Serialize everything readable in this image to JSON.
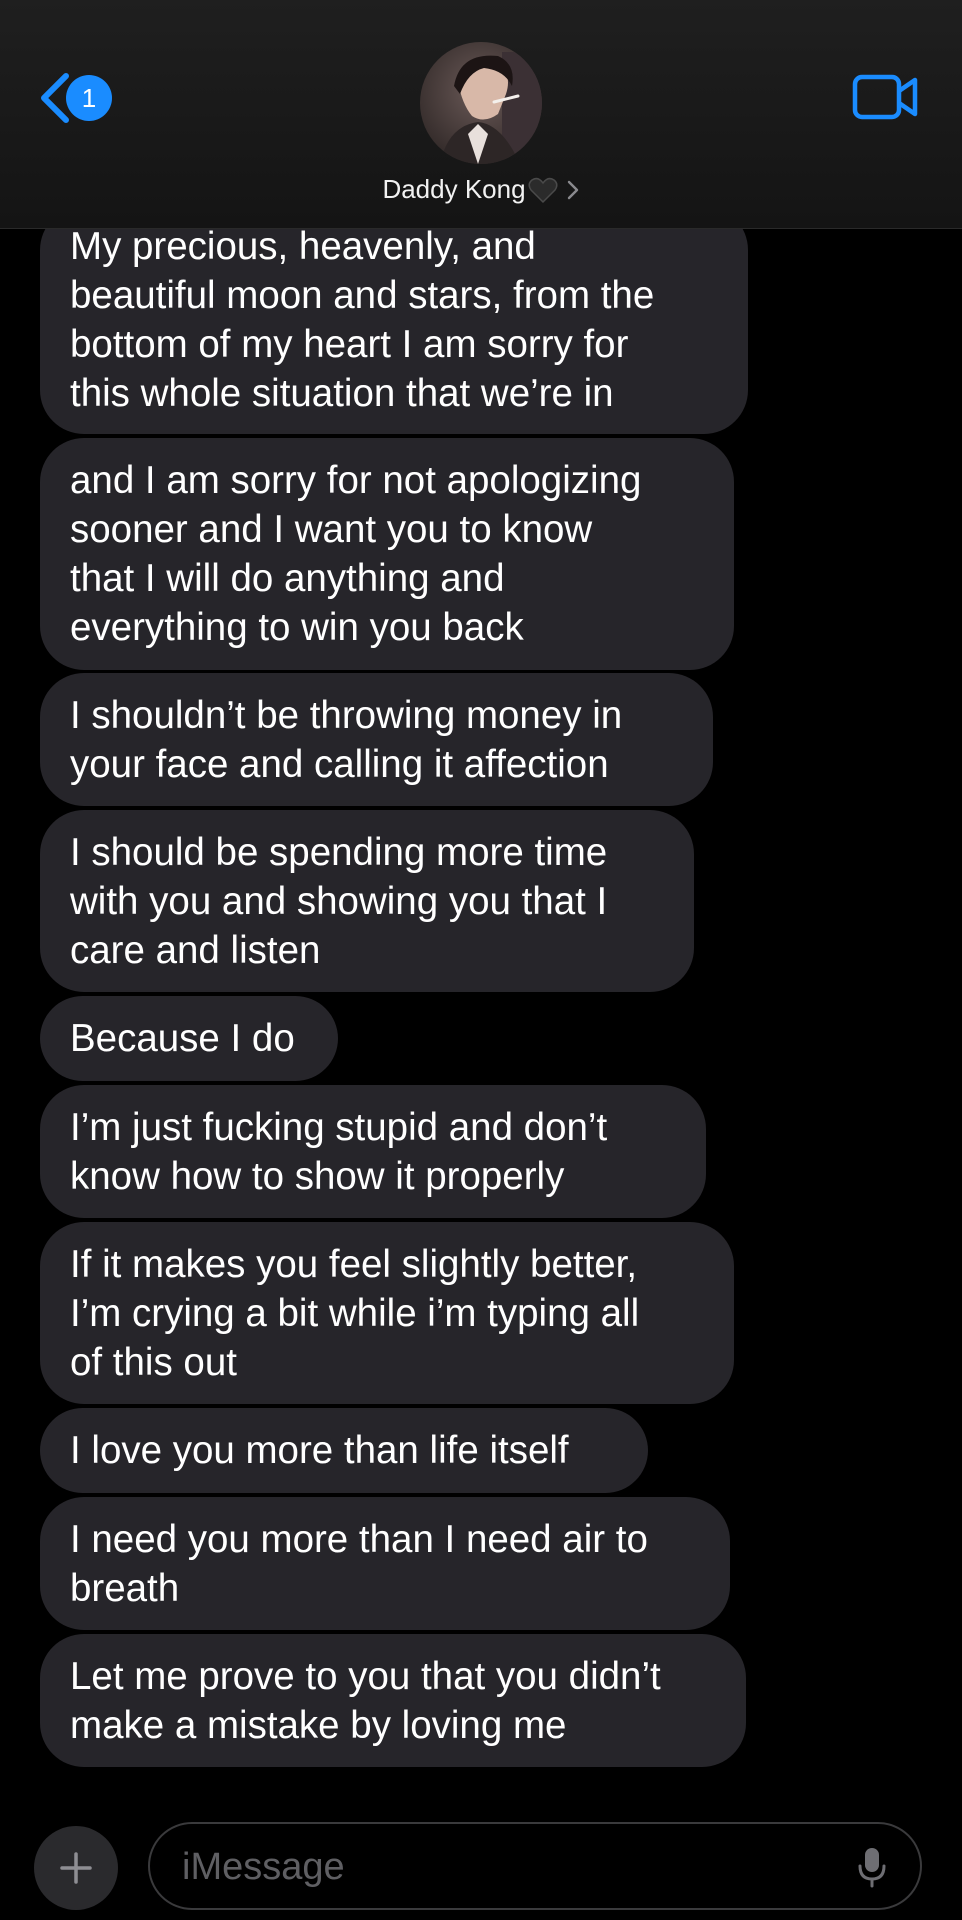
{
  "header": {
    "back_badge_count": "1",
    "contact_name": "Daddy Kong",
    "icons": {
      "back": "chevron-left-icon",
      "heart": "black-heart-icon",
      "disclosure": "chevron-right-icon",
      "video": "video-camera-icon"
    }
  },
  "messages": [
    {
      "text": "My precious, heavenly, and\nbeautiful moon and stars, from the\nbottom of my heart I am sorry for\nthis whole situation that we’re in"
    },
    {
      "text": "and I am sorry for not apologizing\nsooner and I want you to know\nthat I will do anything and\neverything to win you back"
    },
    {
      "text": "I shouldn’t be throwing money in\nyour face and calling it affection"
    },
    {
      "text": "I should be spending more time\nwith you and showing you that I\ncare and listen"
    },
    {
      "text": "Because I do"
    },
    {
      "text": "I’m just fucking stupid and don’t\nknow how to show it properly"
    },
    {
      "text": "If it makes you feel slightly better,\nI’m crying a bit while i’m typing all\nof this out"
    },
    {
      "text": "I love you more than life itself"
    },
    {
      "text": "I need you more than I need air to\nbreath"
    },
    {
      "text": "Let me prove to you that you didn’t\nmake a mistake by loving me"
    }
  ],
  "composer": {
    "placeholder": "iMessage",
    "value": "",
    "icons": {
      "plus": "plus-icon",
      "mic": "microphone-icon"
    }
  },
  "colors": {
    "accent": "#1a8cff",
    "bubble_incoming": "#26252a",
    "background": "#000000",
    "header_background": "#1c1c1e"
  }
}
